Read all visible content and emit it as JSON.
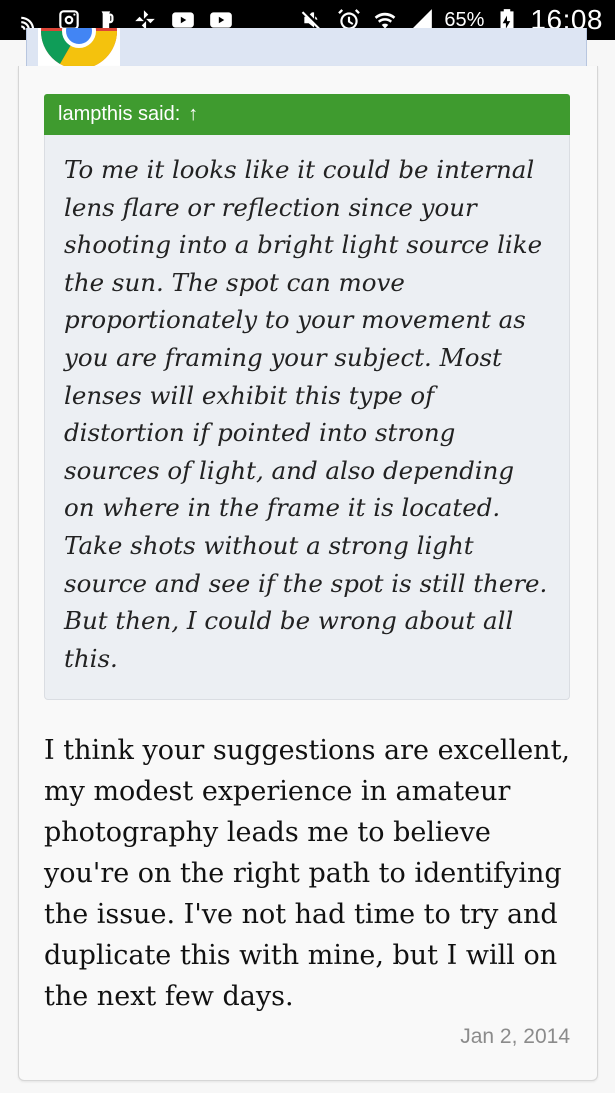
{
  "status_bar": {
    "battery_percent": "65%",
    "time": "16:08"
  },
  "quote": {
    "author_label": "lampthis said:",
    "arrow": "↑",
    "text": "To me it looks like it could be internal lens flare or reflection since your shooting into a bright light source like the sun. The spot can move proportionately to your movement as you are framing your subject. Most lenses will exhibit this type of distortion if pointed into strong sources of light, and also depending on where in the frame it is located. Take shots without a strong light source and see if the spot is still there. But then, I could be wrong about all this."
  },
  "post": {
    "text": "I think your suggestions are excellent, my modest experience in amateur photography leads me to believe you're on the right path to identifying the issue. I've not had time to try and duplicate this with mine, but I will on the next few days.",
    "date": "Jan 2, 2014"
  },
  "colors": {
    "quote_header": "#3f9b2f",
    "quote_body": "#eceff3",
    "prev_post_bg": "#dde5f3",
    "status_bar": "#000000"
  },
  "icons": [
    "cast-icon",
    "instagram-icon",
    "beer-icon",
    "pinwheel-icon",
    "youtube-icon",
    "youtube-icon",
    "mute-icon",
    "alarm-icon",
    "wifi-icon",
    "signal-icon",
    "battery-charging-icon"
  ]
}
